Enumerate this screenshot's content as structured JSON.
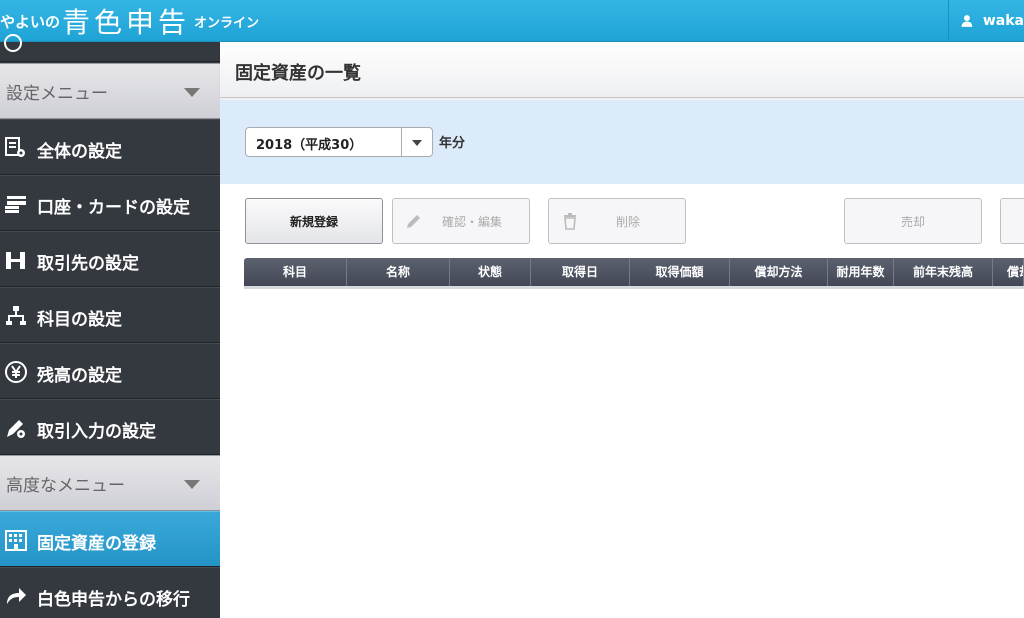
{
  "header": {
    "logo_prefix": "やよいの",
    "logo_main": "青色申告",
    "logo_suffix": "オンライン",
    "user_name": "waka"
  },
  "sidebar": {
    "sections": [
      {
        "label": "設定メニュー"
      },
      {
        "label": "高度なメニュー"
      }
    ],
    "items": [
      {
        "label": "全体の設定",
        "icon": "settings-document-icon"
      },
      {
        "label": "口座・カードの設定",
        "icon": "card-icon"
      },
      {
        "label": "取引先の設定",
        "icon": "partner-icon"
      },
      {
        "label": "科目の設定",
        "icon": "hierarchy-icon"
      },
      {
        "label": "残高の設定",
        "icon": "yen-icon"
      },
      {
        "label": "取引入力の設定",
        "icon": "pen-gear-icon"
      },
      {
        "label": "固定資産の登録",
        "icon": "building-icon",
        "active": true
      },
      {
        "label": "白色申告からの移行",
        "icon": "arrow-icon"
      }
    ]
  },
  "main": {
    "title": "固定資産の一覧",
    "year_select": {
      "value": "2018（平成30）"
    },
    "year_suffix": "年分",
    "buttons": {
      "new": "新規登録",
      "edit": "確認・編集",
      "delete": "削除",
      "sell": "売却"
    },
    "table": {
      "columns": [
        "科目",
        "名称",
        "状態",
        "取得日",
        "取得価額",
        "償却方法",
        "耐用年数",
        "前年末残高",
        "償却"
      ]
    }
  },
  "colors": {
    "header_blue": "#1fa3d6",
    "sidebar_dark": "#34383f",
    "active_blue": "#2493c6",
    "filter_band": "#dcebfa"
  }
}
